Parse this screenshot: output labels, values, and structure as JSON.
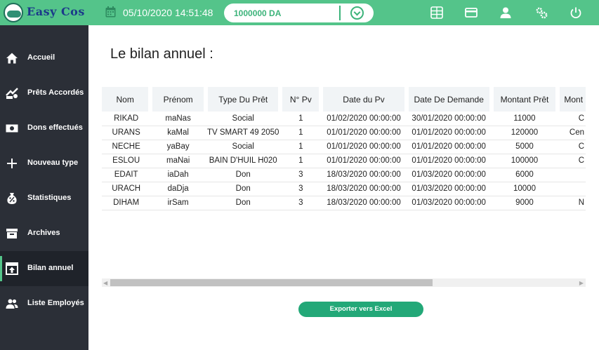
{
  "app": {
    "logo_text": "Easy Cos"
  },
  "topbar": {
    "datetime": "05/10/2020 14:51:48",
    "balance": "1000000 DA",
    "icons": [
      "calendar-icon",
      "excel-icon",
      "card-icon",
      "user-icon",
      "settings-icon",
      "power-icon"
    ]
  },
  "sidebar": {
    "items": [
      {
        "label": "Accueil",
        "icon": "home-icon"
      },
      {
        "label": "Prêts Accordés",
        "icon": "loan-icon"
      },
      {
        "label": "Dons effectués",
        "icon": "money-icon"
      },
      {
        "label": "Nouveau type",
        "icon": "plus-icon"
      },
      {
        "label": "Statistiques",
        "icon": "stats-icon"
      },
      {
        "label": "Archives",
        "icon": "archive-icon"
      },
      {
        "label": "Bilan annuel",
        "icon": "upload-icon",
        "active": true
      },
      {
        "label": "Liste Employés",
        "icon": "people-icon"
      }
    ]
  },
  "main": {
    "title": "Le bilan annuel :",
    "columns": [
      "Nom",
      "Prénom",
      "Type Du Prêt",
      "N° Pv",
      "Date du Pv",
      "Date De Demande",
      "Montant Prêt",
      "Mont"
    ],
    "rows": [
      [
        "RIKAD",
        "maNas",
        "Social",
        "1",
        "01/02/2020 00:00:00",
        "30/01/2020 00:00:00",
        "11000",
        "C"
      ],
      [
        "URANS",
        "kaMal",
        "TV SMART 49 2050",
        "1",
        "01/01/2020 00:00:00",
        "01/01/2020 00:00:00",
        "120000",
        "Cen"
      ],
      [
        "NECHE",
        "yaBay",
        "Social",
        "1",
        "01/01/2020 00:00:00",
        "01/01/2020 00:00:00",
        "5000",
        "C"
      ],
      [
        "ESLOU",
        "maNai",
        "BAIN D'HUIL H020",
        "1",
        "01/01/2020 00:00:00",
        "01/01/2020 00:00:00",
        "100000",
        "C"
      ],
      [
        "EDAIT",
        "iaDah",
        "Don",
        "3",
        "18/03/2020 00:00:00",
        "01/03/2020 00:00:00",
        "6000",
        ""
      ],
      [
        "URACH",
        "daDja",
        "Don",
        "3",
        "18/03/2020 00:00:00",
        "01/03/2020 00:00:00",
        "10000",
        ""
      ],
      [
        "DIHAM",
        "irSam",
        "Don",
        "3",
        "18/03/2020 00:00:00",
        "01/03/2020 00:00:00",
        "9000",
        "N"
      ]
    ],
    "export_label": "Exporter vers Excel"
  }
}
